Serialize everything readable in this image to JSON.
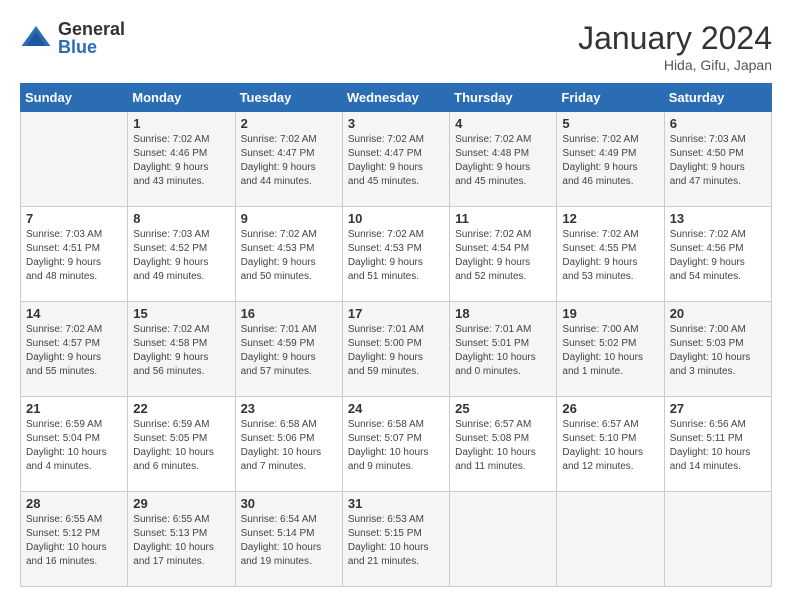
{
  "header": {
    "logo_general": "General",
    "logo_blue": "Blue",
    "title": "January 2024",
    "subtitle": "Hida, Gifu, Japan"
  },
  "columns": [
    "Sunday",
    "Monday",
    "Tuesday",
    "Wednesday",
    "Thursday",
    "Friday",
    "Saturday"
  ],
  "weeks": [
    [
      {
        "day": "",
        "info": ""
      },
      {
        "day": "1",
        "info": "Sunrise: 7:02 AM\nSunset: 4:46 PM\nDaylight: 9 hours\nand 43 minutes."
      },
      {
        "day": "2",
        "info": "Sunrise: 7:02 AM\nSunset: 4:47 PM\nDaylight: 9 hours\nand 44 minutes."
      },
      {
        "day": "3",
        "info": "Sunrise: 7:02 AM\nSunset: 4:47 PM\nDaylight: 9 hours\nand 45 minutes."
      },
      {
        "day": "4",
        "info": "Sunrise: 7:02 AM\nSunset: 4:48 PM\nDaylight: 9 hours\nand 45 minutes."
      },
      {
        "day": "5",
        "info": "Sunrise: 7:02 AM\nSunset: 4:49 PM\nDaylight: 9 hours\nand 46 minutes."
      },
      {
        "day": "6",
        "info": "Sunrise: 7:03 AM\nSunset: 4:50 PM\nDaylight: 9 hours\nand 47 minutes."
      }
    ],
    [
      {
        "day": "7",
        "info": "Sunrise: 7:03 AM\nSunset: 4:51 PM\nDaylight: 9 hours\nand 48 minutes."
      },
      {
        "day": "8",
        "info": "Sunrise: 7:03 AM\nSunset: 4:52 PM\nDaylight: 9 hours\nand 49 minutes."
      },
      {
        "day": "9",
        "info": "Sunrise: 7:02 AM\nSunset: 4:53 PM\nDaylight: 9 hours\nand 50 minutes."
      },
      {
        "day": "10",
        "info": "Sunrise: 7:02 AM\nSunset: 4:53 PM\nDaylight: 9 hours\nand 51 minutes."
      },
      {
        "day": "11",
        "info": "Sunrise: 7:02 AM\nSunset: 4:54 PM\nDaylight: 9 hours\nand 52 minutes."
      },
      {
        "day": "12",
        "info": "Sunrise: 7:02 AM\nSunset: 4:55 PM\nDaylight: 9 hours\nand 53 minutes."
      },
      {
        "day": "13",
        "info": "Sunrise: 7:02 AM\nSunset: 4:56 PM\nDaylight: 9 hours\nand 54 minutes."
      }
    ],
    [
      {
        "day": "14",
        "info": "Sunrise: 7:02 AM\nSunset: 4:57 PM\nDaylight: 9 hours\nand 55 minutes."
      },
      {
        "day": "15",
        "info": "Sunrise: 7:02 AM\nSunset: 4:58 PM\nDaylight: 9 hours\nand 56 minutes."
      },
      {
        "day": "16",
        "info": "Sunrise: 7:01 AM\nSunset: 4:59 PM\nDaylight: 9 hours\nand 57 minutes."
      },
      {
        "day": "17",
        "info": "Sunrise: 7:01 AM\nSunset: 5:00 PM\nDaylight: 9 hours\nand 59 minutes."
      },
      {
        "day": "18",
        "info": "Sunrise: 7:01 AM\nSunset: 5:01 PM\nDaylight: 10 hours\nand 0 minutes."
      },
      {
        "day": "19",
        "info": "Sunrise: 7:00 AM\nSunset: 5:02 PM\nDaylight: 10 hours\nand 1 minute."
      },
      {
        "day": "20",
        "info": "Sunrise: 7:00 AM\nSunset: 5:03 PM\nDaylight: 10 hours\nand 3 minutes."
      }
    ],
    [
      {
        "day": "21",
        "info": "Sunrise: 6:59 AM\nSunset: 5:04 PM\nDaylight: 10 hours\nand 4 minutes."
      },
      {
        "day": "22",
        "info": "Sunrise: 6:59 AM\nSunset: 5:05 PM\nDaylight: 10 hours\nand 6 minutes."
      },
      {
        "day": "23",
        "info": "Sunrise: 6:58 AM\nSunset: 5:06 PM\nDaylight: 10 hours\nand 7 minutes."
      },
      {
        "day": "24",
        "info": "Sunrise: 6:58 AM\nSunset: 5:07 PM\nDaylight: 10 hours\nand 9 minutes."
      },
      {
        "day": "25",
        "info": "Sunrise: 6:57 AM\nSunset: 5:08 PM\nDaylight: 10 hours\nand 11 minutes."
      },
      {
        "day": "26",
        "info": "Sunrise: 6:57 AM\nSunset: 5:10 PM\nDaylight: 10 hours\nand 12 minutes."
      },
      {
        "day": "27",
        "info": "Sunrise: 6:56 AM\nSunset: 5:11 PM\nDaylight: 10 hours\nand 14 minutes."
      }
    ],
    [
      {
        "day": "28",
        "info": "Sunrise: 6:55 AM\nSunset: 5:12 PM\nDaylight: 10 hours\nand 16 minutes."
      },
      {
        "day": "29",
        "info": "Sunrise: 6:55 AM\nSunset: 5:13 PM\nDaylight: 10 hours\nand 17 minutes."
      },
      {
        "day": "30",
        "info": "Sunrise: 6:54 AM\nSunset: 5:14 PM\nDaylight: 10 hours\nand 19 minutes."
      },
      {
        "day": "31",
        "info": "Sunrise: 6:53 AM\nSunset: 5:15 PM\nDaylight: 10 hours\nand 21 minutes."
      },
      {
        "day": "",
        "info": ""
      },
      {
        "day": "",
        "info": ""
      },
      {
        "day": "",
        "info": ""
      }
    ]
  ]
}
